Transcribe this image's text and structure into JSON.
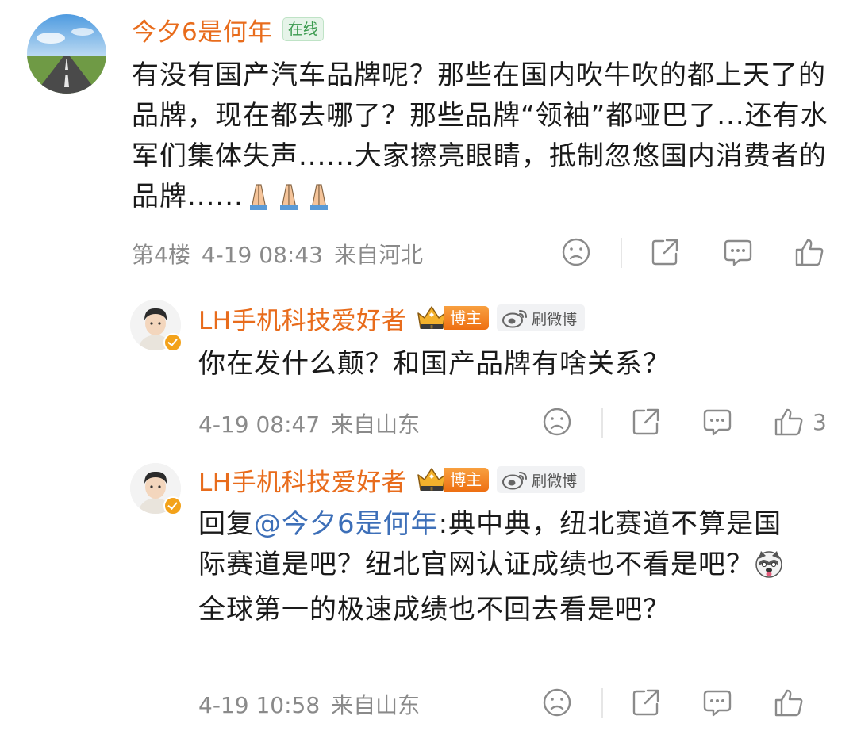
{
  "colors": {
    "username": "#e86c1c",
    "mention": "#3d6fb8",
    "meta": "#8a8a8a"
  },
  "comments": [
    {
      "username": "今夕6是何年",
      "online": "在线",
      "text": "有没有国产汽车品牌呢？那些在国内吹牛吹的都上天了的品牌，现在都去哪了？那些品牌“领袖”都哑巴了...还有水军们集体失声......大家擦亮眼睛，抵制忽悠国内消费者的品牌......",
      "emoji": [
        "praying-hands",
        "praying-hands",
        "praying-hands"
      ],
      "floor": "第4楼",
      "time": "4-19 08:43",
      "location": "来自河北"
    },
    {
      "username": "LH手机科技爱好者",
      "badge": "博主",
      "weibo": "刷微博",
      "text": "你在发什么颠？和国产品牌有啥关系？",
      "time": "4-19 08:47",
      "location": "来自山东",
      "likes": "3"
    },
    {
      "username": "LH手机科技爱好者",
      "badge": "博主",
      "weibo": "刷微博",
      "reply_prefix": "回复",
      "mention": "@今夕6是何年",
      "text_a": ":典中典，纽北赛道不算是国际赛道是吧？纽北官网认证成绩也不看是吧？",
      "emoji": "husky-face",
      "text_b": "全球第一的极速成绩也不回去看是吧？",
      "time": "4-19 10:58",
      "location": "来自山东"
    }
  ]
}
